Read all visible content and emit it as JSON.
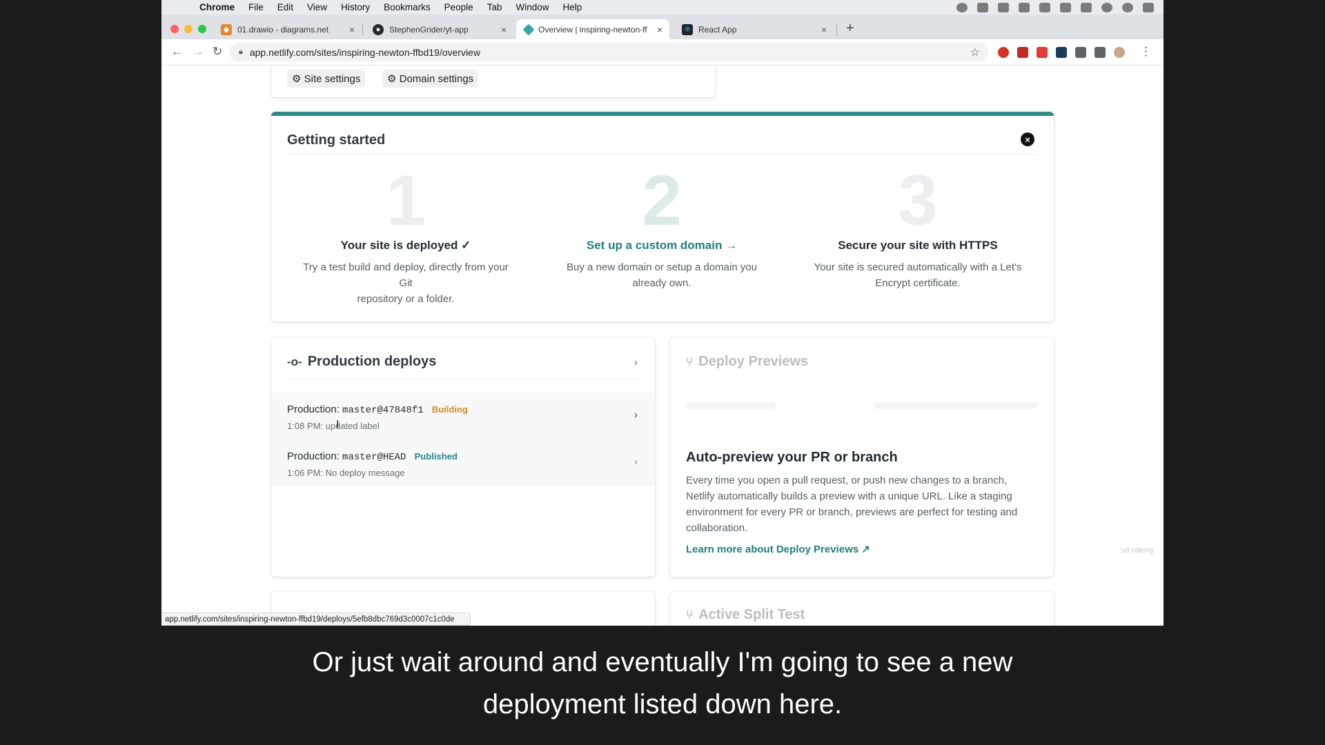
{
  "menubar": {
    "app": "Chrome",
    "items": [
      "File",
      "Edit",
      "View",
      "History",
      "Bookmarks",
      "People",
      "Tab",
      "Window",
      "Help"
    ]
  },
  "tabs": [
    {
      "title": "01.drawio - diagrams.net",
      "favicon_color": "#e8862b"
    },
    {
      "title": "StephenGrider/yt-app",
      "favicon_color": "#24292e"
    },
    {
      "title": "Overview | inspiring-newton-ff",
      "favicon_color": "#31a8a0"
    },
    {
      "title": "React App",
      "favicon_color": "#20232a"
    }
  ],
  "address": {
    "url": "app.netlify.com/sites/inspiring-newton-ffbd19/overview"
  },
  "settings": {
    "site_settings": "Site settings",
    "domain_settings": "Domain settings"
  },
  "getting_started": {
    "title": "Getting started",
    "steps": [
      {
        "num": "1",
        "title": "Your site is deployed ✓",
        "desc_line1": "Try a test build and deploy, directly from your Git",
        "desc_line2": "repository or a folder."
      },
      {
        "num": "2",
        "title": "Set up a custom domain →",
        "desc_line1": "Buy a new domain or setup a domain you",
        "desc_line2": "already own."
      },
      {
        "num": "3",
        "title": "Secure your site with HTTPS",
        "desc_line1": "Your site is secured automatically with a Let's",
        "desc_line2": "Encrypt certificate."
      }
    ]
  },
  "production_deploys": {
    "title": "Production deploys",
    "rows": [
      {
        "label": "Production: ",
        "commit": "master@47848f1",
        "badge": "Building",
        "badge_color": "#d58a1a",
        "sub": "1:08 PM: updated label"
      },
      {
        "label": "Production: ",
        "commit": "master@HEAD",
        "badge": "Published",
        "badge_color": "#1b8b8f",
        "sub": "1:06 PM: No deploy message"
      }
    ]
  },
  "deploy_previews": {
    "title": "Deploy Previews",
    "heading": "Auto-preview your PR or branch",
    "text": "Every time you open a pull request, or push new changes to a branch, Netlify automatically builds a preview with a unique URL. Like a staging environment for every PR or branch, previews are perfect for testing and collaboration.",
    "link": "Learn more about Deploy Previews ↗"
  },
  "split_test": {
    "title": "Active Split Test"
  },
  "status_url": "app.netlify.com/sites/inspiring-newton-ffbd19/deploys/5efb8dbc769d3c0007c1c0de",
  "subtitle": {
    "line1": "Or just wait around and eventually I'm going to see a new",
    "line2": "deployment listed down here."
  },
  "colors": {
    "accent": "#1b7f84",
    "top_border": "#2e8b8b"
  }
}
